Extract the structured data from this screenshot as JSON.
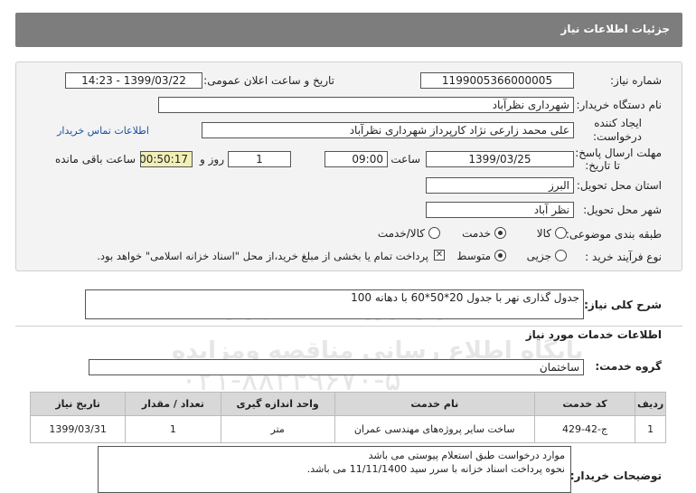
{
  "header": {
    "title": "جزئیات اطلاعات نیاز"
  },
  "fields": {
    "need_number": {
      "label": "شماره نیاز:",
      "value": "1199005366000005"
    },
    "announce": {
      "label": "تاریخ و ساعت اعلان عمومی:",
      "value": "1399/03/22 - 14:23"
    },
    "buyer": {
      "label": "نام دستگاه خریدار:",
      "value": "شهرداری نظرآباد"
    },
    "creator": {
      "label_1": "ایجاد کننده",
      "label_2": "درخواست:",
      "value": "علی محمد زارعی نژاد کارپرداز شهرداری نظرآباد",
      "contact_link": "اطلاعات تماس خریدار"
    },
    "deadline": {
      "label_1": "مهلت ارسال پاسخ:",
      "label_2": "تا تاریخ:",
      "date": "1399/03/25",
      "time_label": "ساعت",
      "time": "09:00",
      "days": "1",
      "days_label": "روز و",
      "remaining": "00:50:17",
      "remaining_label": "ساعت باقی مانده"
    },
    "province": {
      "label": "استان محل تحویل:",
      "value": "البرز"
    },
    "city": {
      "label": "شهر محل تحویل:",
      "value": "نظر آباد"
    },
    "category": {
      "label": "طبقه بندی موضوعی:",
      "options": [
        "کالا",
        "خدمت",
        "کالا/خدمت"
      ],
      "selected": "خدمت"
    },
    "process": {
      "label": "نوع فرآیند خرید :",
      "options": [
        "جزیی",
        "متوسط"
      ],
      "selected": "متوسط",
      "payment_note": "پرداخت تمام یا بخشی از مبلغ خرید،از محل \"اسناد خزانه اسلامی\" خواهد بود.",
      "payment_checked": true
    }
  },
  "summary": {
    "label": "شرح کلی نیاز:",
    "value": "جدول گذاری نهر با جدول 20*50*60 با دهانه 100"
  },
  "services": {
    "title": "اطلاعات خدمات مورد نیاز",
    "group_label": "گروه خدمت:",
    "group_value": "ساختمان",
    "columns": [
      "ردیف",
      "کد خدمت",
      "نام خدمت",
      "واحد اندازه گیری",
      "تعداد / مقدار",
      "تاریخ نیاز"
    ],
    "rows": [
      [
        "1",
        "ج-42-429",
        "ساخت سایر پروژه‌های مهندسی عمران",
        "متر",
        "1",
        "1399/03/31"
      ]
    ]
  },
  "buyer_notes": {
    "label": "توضیحات خریدار:",
    "lines": [
      "موارد درخواست طبق استعلام پیوستی می باشد",
      "نحوه پرداخت اسناد خزانه با سرر سید 11/11/1400 می باشد."
    ]
  },
  "watermark": {
    "brand": "ParsNamadData",
    "line_1": "مرکز فراوری اطلاعات پارس نماد داده",
    "line_2": "پایگاه اطلاع رسانی مناقصه ومزایده",
    "phone": "۰۲۱-۸۸۳۴۹۶۷۰-۵"
  }
}
